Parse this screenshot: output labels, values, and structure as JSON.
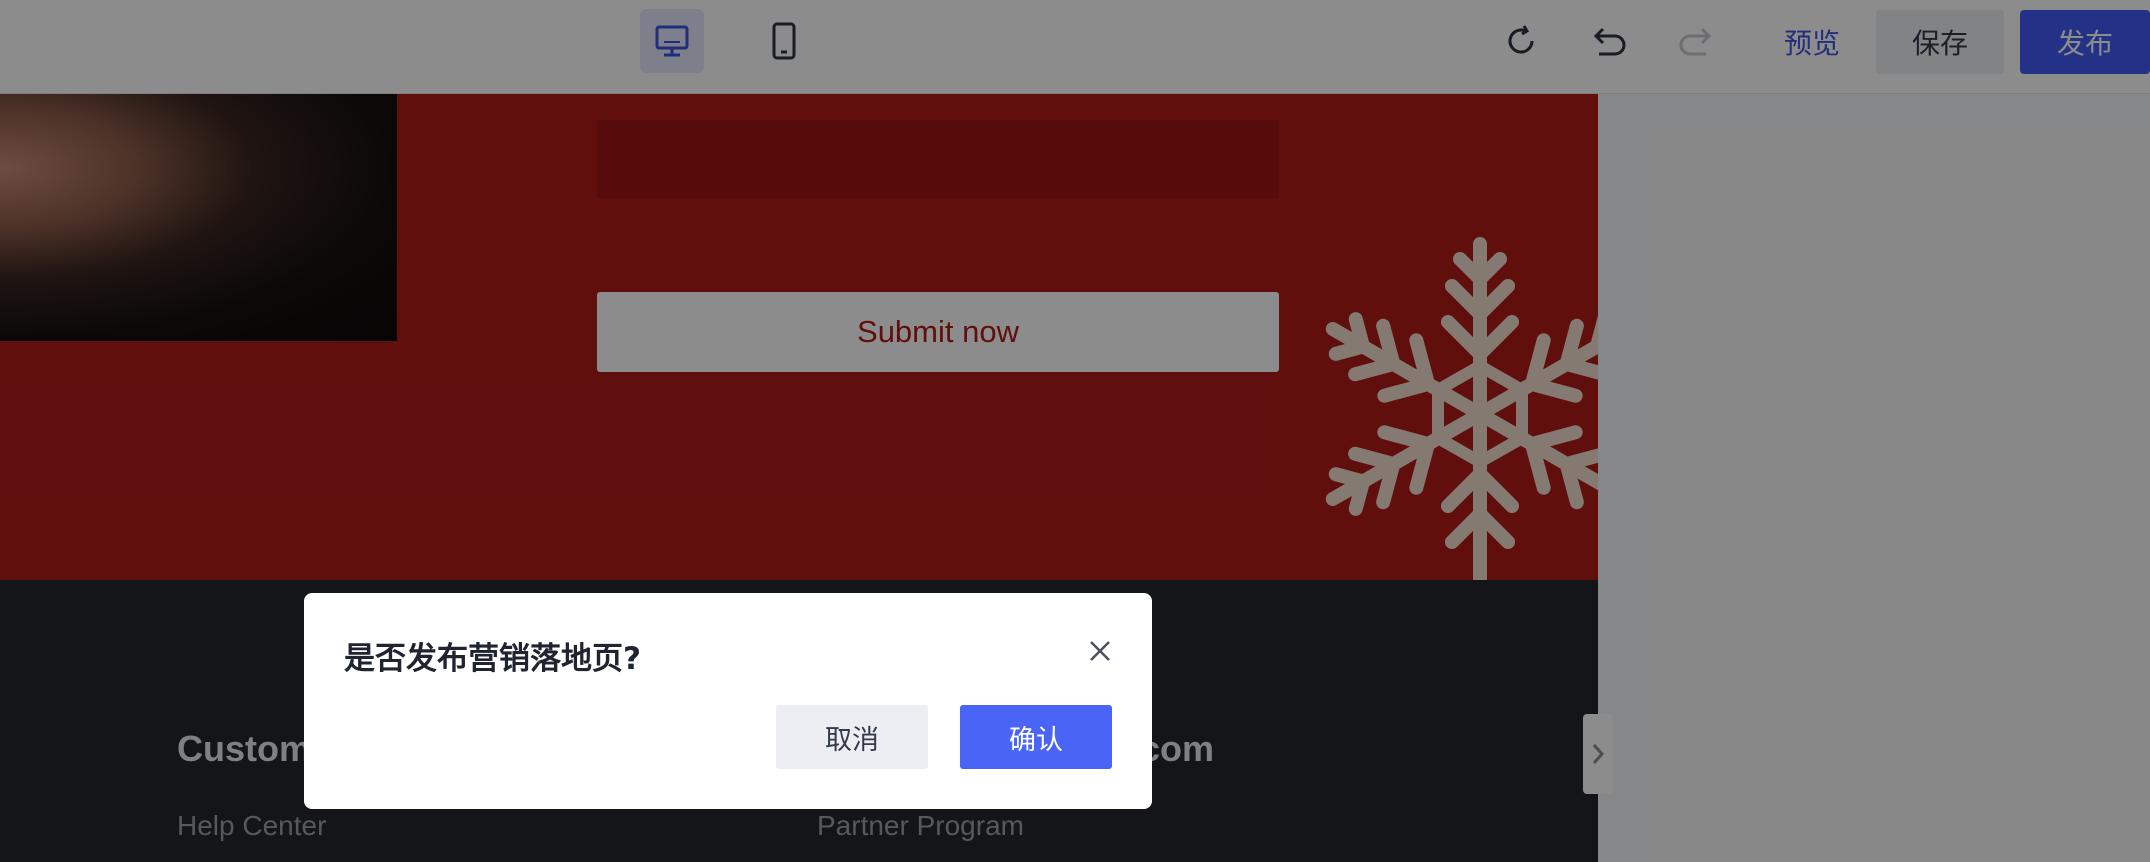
{
  "toolbar": {
    "desktop_icon": "desktop-monitor-icon",
    "mobile_icon": "mobile-phone-icon",
    "refresh_icon": "refresh-icon",
    "undo_icon": "undo-icon",
    "redo_icon": "redo-icon",
    "preview_label": "预览",
    "save_label": "保存",
    "publish_label": "发布"
  },
  "canvas": {
    "submit_label": "Submit now",
    "footer": {
      "heading_left": "Custom",
      "heading_right": "com",
      "link_left": "Help Center",
      "link_right": "Partner Program"
    }
  },
  "modal": {
    "title": "是否发布营销落地页?",
    "close_icon": "close-icon",
    "cancel_label": "取消",
    "confirm_label": "确认"
  },
  "colors": {
    "accent": "#4059f5",
    "banner_red": "#b01c19",
    "footer_dark": "#24272e"
  }
}
